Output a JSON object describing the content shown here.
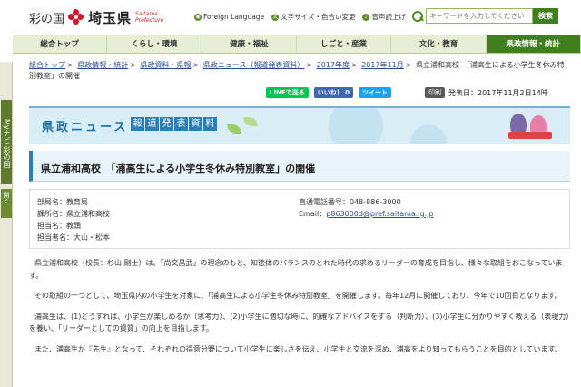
{
  "header": {
    "logo_prefix": "彩の国",
    "logo_name": "埼玉県",
    "logo_roman_1": "Saitama",
    "logo_roman_2": "Prefecture",
    "links": [
      {
        "label": "Foreign Language"
      },
      {
        "label": "文字サイズ・色合い変更"
      },
      {
        "label": "音声読上げ"
      }
    ],
    "search_placeholder": "キーワードを入力してください",
    "search_button": "検索"
  },
  "nav": {
    "items": [
      {
        "label": "総合トップ"
      },
      {
        "label": "くらし・環境"
      },
      {
        "label": "健康・福祉"
      },
      {
        "label": "しごと・産業"
      },
      {
        "label": "文化・教育"
      },
      {
        "label": "県政情報・統計",
        "active": true
      }
    ]
  },
  "side_tab": {
    "label": "Myナビ 彩の国",
    "open_label": "開く"
  },
  "breadcrumb": {
    "items": [
      "総合トップ",
      "県政情報・統計",
      "県政資料・県報",
      "県政ニュース（報道発表資料）",
      "2017年度",
      "2017年11月"
    ],
    "current": "県立浦和高校　「浦高生による小学生冬休み特別教室」の開催"
  },
  "share": {
    "line": "LINEで送る",
    "facebook": "いいね！ 0",
    "twitter": "ツイート"
  },
  "print": {
    "button": "印刷",
    "date": "発表日：2017年11月2日14時"
  },
  "banner": {
    "title": "県政ニュース",
    "subtitle_chars": [
      "報",
      "道",
      "発",
      "表",
      "資",
      "料"
    ]
  },
  "title": "県立浦和高校　「浦高生による小学生冬休み特別教室」の開催",
  "info": {
    "left": [
      "部局名：教育局",
      "課所名：県立浦和高校",
      "担当名：教頭",
      "担当者名：大山・松本"
    ],
    "phone": "直通電話番号：048-886-3000",
    "email_label": "Email：",
    "email": "p863000d@pref.saitama.lg.jp"
  },
  "body": [
    "県立浦和高校（校長：杉山 剛士）は、「尚文昌武」の理念のもと、知徳体のバランスのとれた時代の求めるリーダーの育成を目指し、様々な取組をおこなっています。",
    "その取組の一つとして、埼玉県内の小学生を対象に、「浦高生による小学生冬休み特別教室」を開催します。毎年12月に開催しており、今年で10回目となります。",
    "浦高生は、(1)どうすれば、小学生が楽しめるか（思考力）、(2)小学生に適切な時に、的確なアドバイスをする（判断力）、(3)小学生に分かりやすく教える（表現力）を養い、「リーダーとしての資質」の向上を目指します。",
    "また、浦高生が『先生』となって、それぞれの得意分野について小学生に楽しさを伝え、小学生と交流を深め、浦高をより知ってもらうことを目的としています。"
  ],
  "colors": {
    "brand_green": "#3f7f1d",
    "nav_bg": "#e6efd6",
    "banner_blue": "#2b7fb8",
    "link": "#2a4d9a"
  }
}
